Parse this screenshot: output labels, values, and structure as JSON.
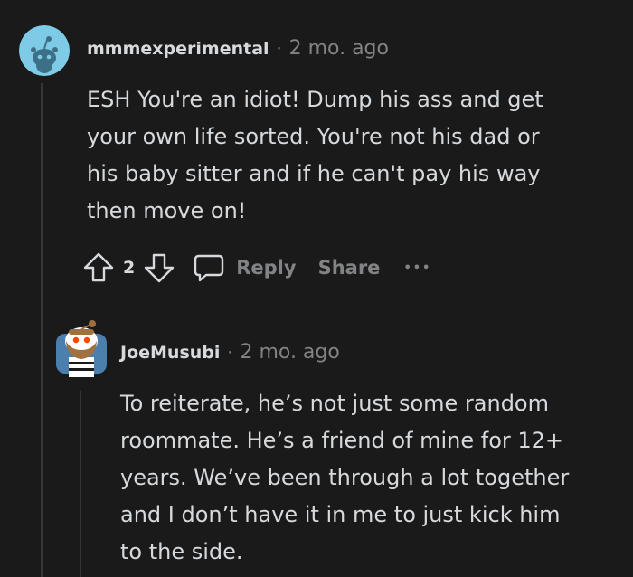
{
  "comments": [
    {
      "username": "mmmexperimental",
      "separator": "·",
      "timestamp": "2 mo. ago",
      "avatar_icon": "snoo-avatar-icon",
      "body_lines": [
        "ESH You're an idiot! Dump his ass and get",
        "your own life sorted. You're not his dad or",
        "his baby sitter and if he can't pay his way",
        "then move on!"
      ],
      "actions": {
        "upvote_icon": "upvote-arrow-icon",
        "score": "2",
        "downvote_icon": "downvote-arrow-icon",
        "reply_icon": "speech-bubble-icon",
        "reply_label": "Reply",
        "share_label": "Share",
        "more_icon": "ellipsis-icon",
        "more_label": "•••"
      }
    },
    {
      "username": "JoeMusubi",
      "separator": "·",
      "timestamp": "2 mo. ago",
      "avatar_icon": "bearded-snoo-avatar-icon",
      "body_lines": [
        "To reiterate, he’s not just some random",
        "roommate. He’s a friend of mine for 12+",
        "years. We’ve been through a lot together",
        "and I don’t have it in me to just kick him",
        "to the side."
      ]
    }
  ],
  "colors": {
    "background": "#1a1a1b",
    "text": "#d7dadc",
    "muted": "#818384",
    "thread_line": "#343536",
    "avatar_bg": "#7ecbe8"
  }
}
